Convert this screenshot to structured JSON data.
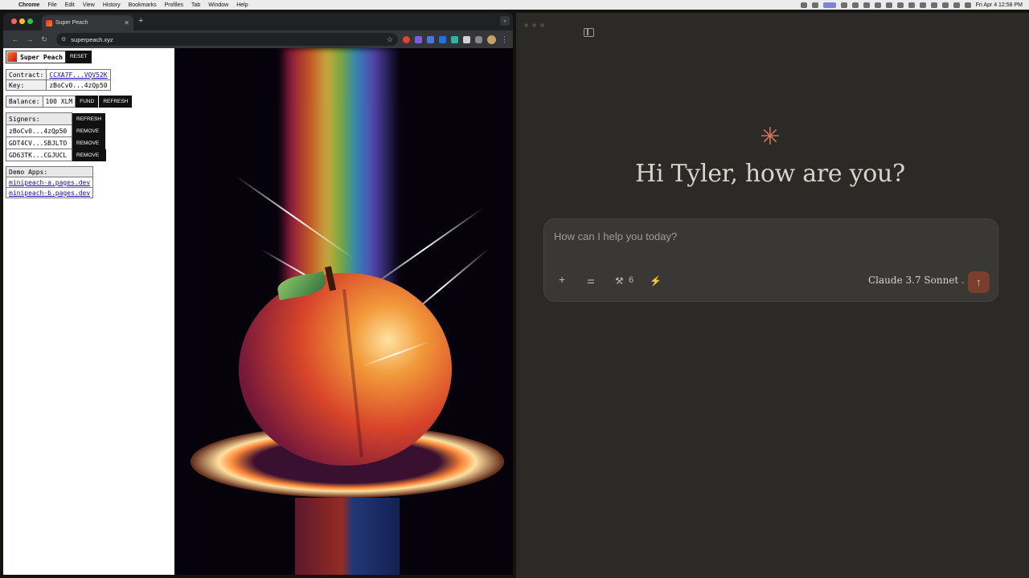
{
  "menubar": {
    "app_name": "Chrome",
    "items": [
      "File",
      "Edit",
      "View",
      "History",
      "Bookmarks",
      "Profiles",
      "Tab",
      "Window",
      "Help"
    ],
    "clock": "Fri Apr 4  12:58 PM"
  },
  "browser": {
    "tab_title": "Super Peach",
    "url": "superpeach.xyz"
  },
  "app": {
    "title": "Super Peach",
    "reset_label": "RESET",
    "contract_label": "Contract:",
    "contract_value": "CCXA7F...VQV52K",
    "key_label": "Key:",
    "key_value": "zBoCv0...4zQp50",
    "balance_label": "Balance:",
    "balance_value": "100 XLM",
    "fund_label": "FUND",
    "refresh_label": "REFRESH",
    "signers_label": "Signers:",
    "signers_refresh_label": "REFRESH",
    "signers": [
      {
        "id": "zBoCv0...4zQp50",
        "action": "REMOVE"
      },
      {
        "id": "GDT4CV...SBJLTO",
        "action": "REMOVE"
      },
      {
        "id": "GD63TK...CGJUCL",
        "action": "REMOVE"
      }
    ],
    "demo_apps_label": "Demo Apps:",
    "demo_apps": [
      "minipeach-a.pages.dev",
      "minipeach-b.pages.dev"
    ]
  },
  "claude": {
    "greeting": "Hi Tyler, how are you?",
    "placeholder": "How can I help you today?",
    "tools_count": "6",
    "model": "Claude 3.7 Sonnet",
    "accent_color": "#d97757"
  }
}
